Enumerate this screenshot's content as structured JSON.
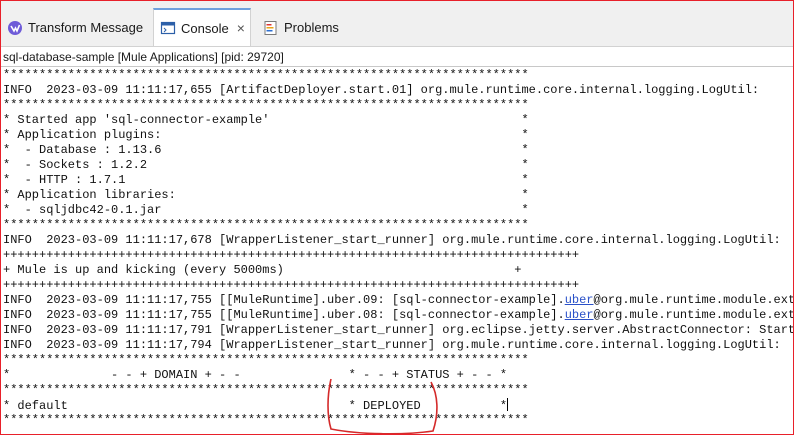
{
  "tabs": [
    {
      "label": "Transform Message",
      "icon": "transform-message-icon",
      "active": false
    },
    {
      "label": "Console",
      "icon": "console-icon",
      "active": true,
      "close": "×"
    },
    {
      "label": "Problems",
      "icon": "problems-icon",
      "active": false
    }
  ],
  "process_label": "sql-database-sample [Mule Applications]  [pid: 29720]",
  "console": {
    "lines": [
      "*************************************************************************",
      "INFO  2023-03-09 11:11:17,655 [ArtifactDeployer.start.01] org.mule.runtime.core.internal.logging.LogUtil:",
      "*************************************************************************",
      "* Started app 'sql-connector-example'                                   *",
      "* Application plugins:                                                  *",
      "*  - Database : 1.13.6                                                  *",
      "*  - Sockets : 1.2.2                                                    *",
      "*  - HTTP : 1.7.1                                                       *",
      "* Application libraries:                                                *",
      "*  - sqljdbc42-0.1.jar                                                  *",
      "*************************************************************************",
      "INFO  2023-03-09 11:11:17,678 [WrapperListener_start_runner] org.mule.runtime.core.internal.logging.LogUtil:",
      "++++++++++++++++++++++++++++++++++++++++++++++++++++++++++++++++++++++++++++++++",
      "+ Mule is up and kicking (every 5000ms)                                +",
      "++++++++++++++++++++++++++++++++++++++++++++++++++++++++++++++++++++++++++++++++",
      "INFO  2023-03-09 11:11:17,755 [[MuleRuntime].uber.09: [sql-connector-example].@@uber@@@org.mule.runtime.module.extens",
      "INFO  2023-03-09 11:11:17,755 [[MuleRuntime].uber.08: [sql-connector-example].@@uber@@@org.mule.runtime.module.extens",
      "INFO  2023-03-09 11:11:17,791 [WrapperListener_start_runner] org.eclipse.jetty.server.AbstractConnector: Started",
      "INFO  2023-03-09 11:11:17,794 [WrapperListener_start_runner] org.mule.runtime.core.internal.logging.LogUtil:",
      "*************************************************************************",
      "*              - - + DOMAIN + - -               * - - + STATUS + - - *",
      "*************************************************************************",
      "* default                                       * DEPLOYED           *",
      "*************************************************************************"
    ],
    "cursor_line": 22
  },
  "annotation_color": "#d42a2a"
}
